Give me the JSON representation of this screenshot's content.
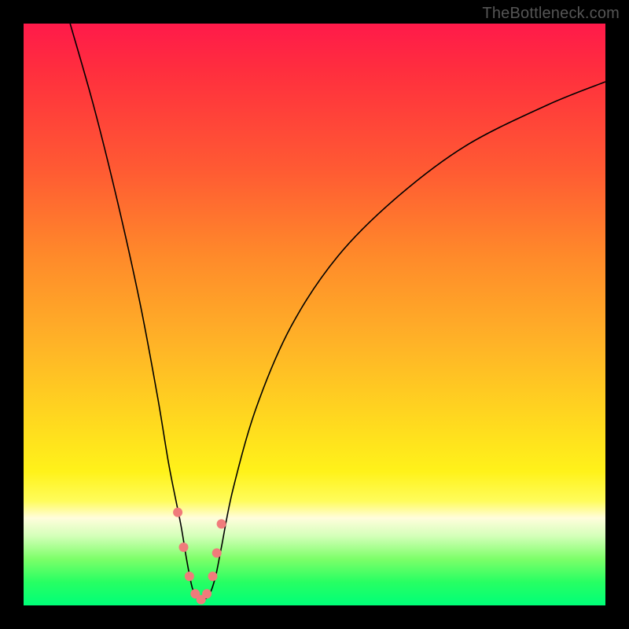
{
  "watermark": "TheBottleneck.com",
  "chart_data": {
    "type": "line",
    "title": "",
    "xlabel": "",
    "ylabel": "",
    "xlim": [
      0,
      100
    ],
    "ylim": [
      0,
      100
    ],
    "grid": false,
    "series": [
      {
        "name": "bottleneck-curve",
        "x": [
          8,
          12,
          16,
          20,
          23,
          25,
          27,
          28,
          29,
          30,
          31,
          32,
          33,
          34,
          36,
          40,
          46,
          54,
          64,
          76,
          90,
          100
        ],
        "values": [
          100,
          86,
          70,
          52,
          36,
          24,
          14,
          8,
          3,
          1,
          1,
          2,
          5,
          10,
          20,
          34,
          48,
          60,
          70,
          79,
          86,
          90
        ]
      }
    ],
    "markers": {
      "name": "near-minimum-dots",
      "x": [
        26.5,
        27.5,
        28.5,
        29.5,
        30.5,
        31.5,
        32.5,
        33.2,
        34.0
      ],
      "values": [
        16,
        10,
        5,
        2,
        1,
        2,
        5,
        9,
        14
      ]
    },
    "background_gradient": {
      "top": "#ff1a4a",
      "mid": "#ffd81f",
      "bottom": "#00ff78"
    }
  }
}
